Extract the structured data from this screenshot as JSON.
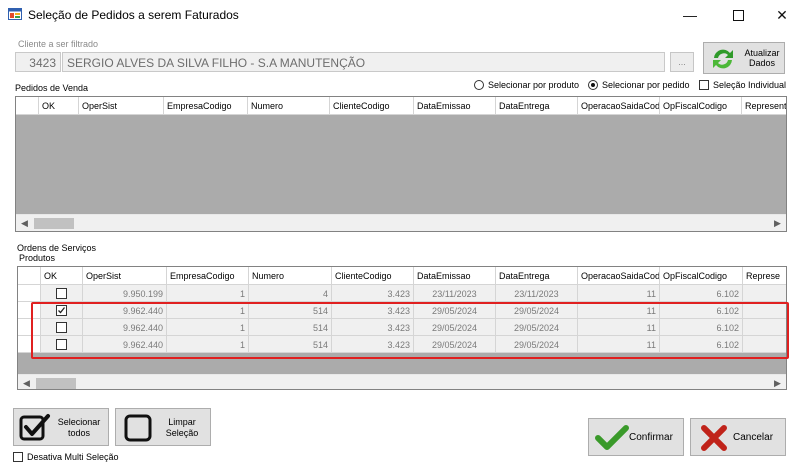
{
  "window": {
    "title": "Seleção de Pedidos a serem Faturados"
  },
  "client": {
    "group_label": "Cliente a ser filtrado",
    "code": "3423",
    "name": "SERGIO ALVES DA SILVA FILHO - S.A MANUTENÇÃO",
    "browse_label": "...",
    "refresh_label_1": "Atualizar",
    "refresh_label_2": "Dados"
  },
  "sales_orders": {
    "label": "Pedidos de Venda",
    "radio_product": "Selecionar por produto",
    "radio_order": "Selecionar por pedido",
    "radio_selected": "order",
    "individual_label": "Seleção Individual",
    "columns": [
      "OK",
      "OperSist",
      "EmpresaCodigo",
      "Numero",
      "ClienteCodigo",
      "DataEmissao",
      "DataEntrega",
      "OperacaoSaidaCod",
      "OpFiscalCodigo",
      "Represent"
    ]
  },
  "service_orders": {
    "label": "Ordens de Serviços"
  },
  "products": {
    "label": "Produtos",
    "columns": [
      "OK",
      "OperSist",
      "EmpresaCodigo",
      "Numero",
      "ClienteCodigo",
      "DataEmissao",
      "DataEntrega",
      "OperacaoSaidaCod",
      "OpFiscalCodigo",
      "Represe"
    ],
    "rows": [
      {
        "ok": false,
        "opersist": "9.950.199",
        "empresa": "1",
        "numero": "4",
        "cliente": "3.423",
        "emissao": "23/11/2023",
        "entrega": "23/11/2023",
        "opsaida": "11",
        "opfiscal": "6.102"
      },
      {
        "ok": true,
        "opersist": "9.962.440",
        "empresa": "1",
        "numero": "514",
        "cliente": "3.423",
        "emissao": "29/05/2024",
        "entrega": "29/05/2024",
        "opsaida": "11",
        "opfiscal": "6.102"
      },
      {
        "ok": false,
        "opersist": "9.962.440",
        "empresa": "1",
        "numero": "514",
        "cliente": "3.423",
        "emissao": "29/05/2024",
        "entrega": "29/05/2024",
        "opsaida": "11",
        "opfiscal": "6.102"
      },
      {
        "ok": false,
        "opersist": "9.962.440",
        "empresa": "1",
        "numero": "514",
        "cliente": "3.423",
        "emissao": "29/05/2024",
        "entrega": "29/05/2024",
        "opsaida": "11",
        "opfiscal": "6.102"
      }
    ]
  },
  "buttons": {
    "select_all_1": "Selecionar",
    "select_all_2": "todos",
    "clear_1": "Limpar",
    "clear_2": "Seleção",
    "confirm": "Confirmar",
    "cancel": "Cancelar",
    "multi_select": "Desativa Multi Seleção"
  },
  "colors": {
    "highlight": "#e02020",
    "accent_green": "#3a9a2a",
    "cancel_red": "#c0231a"
  }
}
